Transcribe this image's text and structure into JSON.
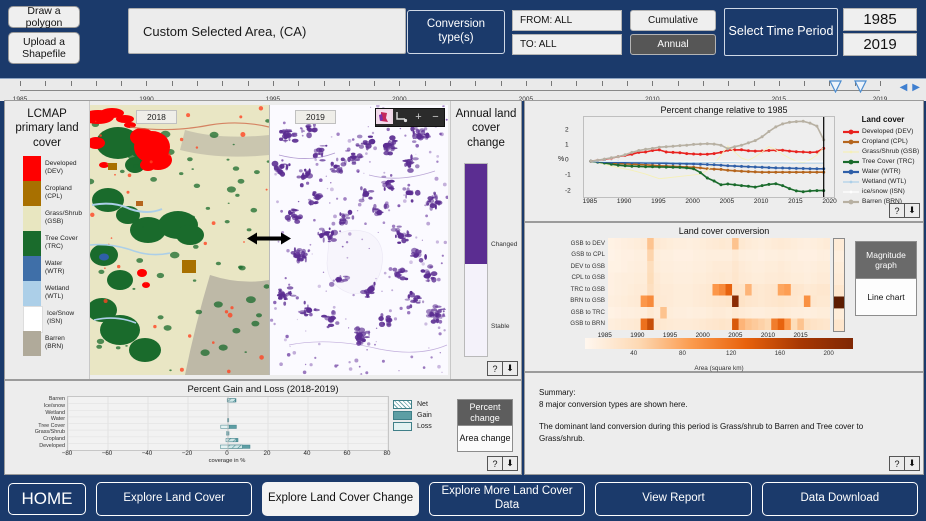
{
  "header": {
    "draw_polygon_label": "Draw a polygon",
    "upload_shapefile_label": "Upload a Shapefile",
    "area_label": "Custom Selected Area, (CA)",
    "conversion_types_label": "Conversion type(s)",
    "from_label": "FROM:  ALL",
    "to_label": "TO: ALL",
    "cumulative_label": "Cumulative",
    "annual_label": "Annual",
    "select_time_period_label": "Select Time Period",
    "year_start": "1985",
    "year_end": "2019"
  },
  "timeline": {
    "ticks": [
      1985,
      1986,
      1987,
      1988,
      1989,
      1990,
      1991,
      1992,
      1993,
      1994,
      1995,
      1996,
      1997,
      1998,
      1999,
      2000,
      2001,
      2002,
      2003,
      2004,
      2005,
      2006,
      2007,
      2008,
      2009,
      2010,
      2011,
      2012,
      2013,
      2014,
      2015,
      2016,
      2017,
      2018,
      2019
    ],
    "labels": [
      "1985",
      "1990",
      "1995",
      "2000",
      "2005",
      "2010",
      "2015",
      "2019"
    ],
    "label_years": [
      1985,
      1990,
      1995,
      2000,
      2005,
      2010,
      2015,
      2019
    ],
    "handle_start": 2018,
    "handle_end": 2019,
    "prev_icon": "prev-arrow-icon",
    "next_icon": "next-arrow-icon"
  },
  "legend": {
    "title": "LCMAP primary land cover",
    "items": [
      {
        "label": "Developed (DEV)",
        "color": "#ff0000"
      },
      {
        "label": "Cropland (CPL)",
        "color": "#a87000"
      },
      {
        "label": "Grass/Shrub (GSB)",
        "color": "#e8e6c0"
      },
      {
        "label": "Tree Cover (TRC)",
        "color": "#1a6b2c"
      },
      {
        "label": "Water (WTR)",
        "color": "#3f6fa8"
      },
      {
        "label": "Wetland (WTL)",
        "color": "#accfe8"
      },
      {
        "label": "Ice/Snow (ISN)",
        "color": "#ffffff"
      },
      {
        "label": "Barren (BRN)",
        "color": "#b0aa9a"
      }
    ]
  },
  "map": {
    "left_year": "2018",
    "right_year": "2019",
    "tools": [
      "thumbnail-icon",
      "swipe-icon",
      "zoom-in-icon",
      "zoom-out-icon"
    ],
    "zoom_in_glyph": "+",
    "zoom_out_glyph": "−"
  },
  "change_legend": {
    "title": "Annual land cover change",
    "changed_label": "Changed",
    "stable_label": "Stable",
    "changed_color": "#5b2d91",
    "stable_color": "#f4f2fa"
  },
  "help_buttons": {
    "help_glyph": "?",
    "download_glyph": "⬇"
  },
  "gain_loss": {
    "title": "Percent Gain and Loss (2018-2019)",
    "xlabel": "coverage in %",
    "legend": [
      {
        "label": "Net",
        "style": "hatched"
      },
      {
        "label": "Gain",
        "style": "solid"
      },
      {
        "label": "Loss",
        "style": "light"
      }
    ],
    "toggle": {
      "percent_change": "Percent change",
      "area_change": "Area change",
      "selected": "Percent change"
    }
  },
  "line_panel": {
    "magnitude_label": "Magnitude graph",
    "line_chart_label": "Line chart",
    "selected": "Magnitude graph"
  },
  "summary": {
    "heading": "Summary:",
    "line1": "8 major conversion types are shown here.",
    "line2": "The dominant land conversion during this period is Grass/shrub to Barren and Tree cover to Grass/shrub."
  },
  "nav": {
    "home_label": "HOME",
    "items": [
      {
        "label": "Explore Land Cover",
        "active": false
      },
      {
        "label": "Explore Land Cover Change",
        "active": true
      },
      {
        "label": "Explore More Land Cover Data",
        "active": false
      },
      {
        "label": "View Report",
        "active": false
      },
      {
        "label": "Data Download",
        "active": false
      }
    ]
  },
  "chart_data": [
    {
      "type": "line",
      "title": "Percent change relative to 1985",
      "xlabel": "",
      "ylabel": "%",
      "legend_title": "Land cover",
      "legend_position": "right",
      "grid": false,
      "xlim": [
        1984,
        2020.5
      ],
      "ylim": [
        -2.35,
        2.9
      ],
      "xticks": [
        1985,
        1990,
        1995,
        2000,
        2005,
        2010,
        2015,
        2020
      ],
      "yticks": [
        -2,
        -1,
        0,
        1,
        2
      ],
      "marker_year": 2019,
      "x": [
        1985,
        1986,
        1987,
        1988,
        1989,
        1990,
        1991,
        1992,
        1993,
        1994,
        1995,
        1996,
        1997,
        1998,
        1999,
        2000,
        2001,
        2002,
        2003,
        2004,
        2005,
        2006,
        2007,
        2008,
        2009,
        2010,
        2011,
        2012,
        2013,
        2014,
        2015,
        2016,
        2017,
        2018,
        2019
      ],
      "series": [
        {
          "name": "Developed (DEV)",
          "color": "#e8221f",
          "values": [
            0,
            0.05,
            0.12,
            0.2,
            0.3,
            0.38,
            0.46,
            0.58,
            0.6,
            0.7,
            0.74,
            0.6,
            0.58,
            0.56,
            0.5,
            0.47,
            0.45,
            0.46,
            0.5,
            0.58,
            0.72,
            0.74,
            0.75,
            0.68,
            0.66,
            0.67,
            0.7,
            0.72,
            0.72,
            0.66,
            0.62,
            0.6,
            0.58,
            0.6,
            0.84
          ]
        },
        {
          "name": "Cropland (CPL)",
          "color": "#b5651d",
          "values": [
            0,
            -0.05,
            -0.1,
            -0.13,
            -0.15,
            -0.17,
            -0.2,
            -0.22,
            -0.24,
            -0.27,
            -0.3,
            -0.32,
            -0.34,
            -0.36,
            -0.38,
            -0.4,
            -0.44,
            -0.5,
            -0.52,
            -0.54,
            -0.6,
            -0.63,
            -0.66,
            -0.68,
            -0.7,
            -0.72,
            -0.72,
            -0.72,
            -0.72,
            -0.72,
            -0.72,
            -0.72,
            -0.72,
            -0.72,
            -0.72
          ]
        },
        {
          "name": "Grass/Shrub (GSB)",
          "color": "#f5f0b8",
          "values": [
            0,
            -0.1,
            -0.2,
            -0.32,
            -0.42,
            -0.5,
            -0.6,
            -0.72,
            -0.85,
            -1.0,
            -1.15,
            -1.1,
            -1.05,
            -1.0,
            -0.95,
            -0.9,
            -0.85,
            -0.6,
            -0.2,
            0.4,
            1.0,
            0.6,
            0.2,
            0.05,
            0.3,
            0.6,
            0.95,
            0.75,
            0.45,
            0.2,
            0.0,
            -0.1,
            0.1,
            0.4,
            0.9
          ]
        },
        {
          "name": "Tree Cover (TRC)",
          "color": "#1a6b2c",
          "values": [
            0,
            -0.06,
            -0.12,
            -0.2,
            -0.26,
            -0.3,
            -0.33,
            -0.34,
            -0.36,
            -0.37,
            -0.38,
            -0.39,
            -0.4,
            -0.41,
            -0.44,
            -0.5,
            -0.75,
            -1.1,
            -1.3,
            -1.55,
            -1.5,
            -1.55,
            -1.6,
            -1.65,
            -1.7,
            -1.6,
            -1.52,
            -1.48,
            -1.6,
            -1.8,
            -1.95,
            -2.0,
            -1.95,
            -1.93,
            -1.93
          ]
        },
        {
          "name": "Water (WTR)",
          "color": "#2f5fa8",
          "values": [
            0,
            -0.02,
            -0.04,
            -0.06,
            -0.07,
            -0.08,
            -0.09,
            -0.1,
            -0.11,
            -0.12,
            -0.13,
            -0.14,
            -0.15,
            -0.16,
            -0.17,
            -0.18,
            -0.2,
            -0.22,
            -0.24,
            -0.26,
            -0.3,
            -0.32,
            -0.34,
            -0.36,
            -0.38,
            -0.4,
            -0.42,
            -0.44,
            -0.45,
            -0.46,
            -0.47,
            -0.48,
            -0.49,
            -0.5,
            -0.5
          ]
        },
        {
          "name": "Wetland (WTL)",
          "color": "#accfe8",
          "values": [
            0,
            -0.01,
            -0.02,
            -0.02,
            -0.03,
            -0.03,
            -0.04,
            -0.04,
            -0.05,
            -0.05,
            -0.06,
            -0.06,
            -0.07,
            -0.07,
            -0.08,
            -0.08,
            -0.08,
            -0.09,
            -0.09,
            -0.1,
            -0.1,
            -0.1,
            -0.11,
            -0.11,
            -0.11,
            -0.12,
            -0.12,
            -0.12,
            -0.12,
            -0.13,
            -0.13,
            -0.13,
            -0.13,
            -0.13,
            -0.13
          ]
        },
        {
          "name": "ice/snow (ISN)",
          "color": "#ffffff",
          "values": [
            0,
            0,
            0,
            0,
            0,
            0,
            0,
            0,
            0,
            0,
            0,
            0,
            0,
            0,
            0,
            0,
            0,
            0,
            0,
            0,
            0,
            0,
            0,
            0,
            0,
            0,
            0,
            0,
            0,
            0,
            0,
            0,
            0,
            0,
            0
          ]
        },
        {
          "name": "Barren (BRN)",
          "color": "#b7b0a2",
          "values": [
            0,
            0.06,
            0.14,
            0.22,
            0.3,
            0.42,
            0.58,
            0.7,
            0.78,
            0.84,
            0.92,
            0.95,
            0.98,
            1.02,
            1.05,
            1.1,
            1.12,
            1.15,
            1.12,
            1.05,
            0.82,
            0.95,
            1.05,
            1.2,
            1.35,
            1.6,
            1.95,
            2.25,
            2.45,
            2.55,
            2.6,
            2.62,
            2.5,
            2.3,
            1.4
          ]
        }
      ]
    },
    {
      "type": "heatmap",
      "title": "Land cover conversion",
      "xlabel": "",
      "ylabel": "",
      "colorbar_label": "Area (square km)",
      "colorbar_ticks": [
        40,
        80,
        120,
        160,
        200
      ],
      "colorbar_range": [
        0,
        220
      ],
      "xticks": [
        1985,
        1990,
        1995,
        2000,
        2005,
        2010,
        2015
      ],
      "x": [
        1986,
        1987,
        1988,
        1989,
        1990,
        1991,
        1992,
        1993,
        1994,
        1995,
        1996,
        1997,
        1998,
        1999,
        2000,
        2001,
        2002,
        2003,
        2004,
        2005,
        2006,
        2007,
        2008,
        2009,
        2010,
        2011,
        2012,
        2013,
        2014,
        2015,
        2016,
        2017,
        2018,
        2019
      ],
      "rows": [
        "GSB to DEV",
        "GSB to CPL",
        "DEV to GSB",
        "CPL to GSB",
        "TRC to GSB",
        "BRN to GSB",
        "GSB to TRC",
        "GSB to BRN"
      ],
      "values": [
        [
          8,
          10,
          12,
          14,
          16,
          18,
          60,
          22,
          18,
          16,
          14,
          14,
          12,
          14,
          16,
          18,
          20,
          22,
          20,
          60,
          22,
          18,
          16,
          14,
          16,
          18,
          20,
          18,
          16,
          14,
          12,
          14,
          16,
          18
        ],
        [
          6,
          8,
          10,
          10,
          12,
          12,
          48,
          14,
          12,
          12,
          10,
          10,
          10,
          12,
          12,
          14,
          14,
          14,
          14,
          20,
          14,
          12,
          12,
          10,
          12,
          12,
          14,
          12,
          12,
          10,
          10,
          10,
          12,
          12
        ],
        [
          8,
          8,
          10,
          12,
          14,
          14,
          38,
          16,
          14,
          14,
          12,
          12,
          12,
          14,
          14,
          16,
          18,
          18,
          18,
          24,
          18,
          16,
          14,
          14,
          16,
          16,
          18,
          16,
          14,
          14,
          12,
          14,
          16,
          16
        ],
        [
          10,
          12,
          14,
          14,
          16,
          16,
          40,
          20,
          16,
          16,
          14,
          14,
          14,
          16,
          16,
          18,
          20,
          22,
          20,
          26,
          20,
          18,
          16,
          16,
          18,
          18,
          20,
          18,
          16,
          16,
          14,
          16,
          18,
          18
        ],
        [
          10,
          12,
          14,
          16,
          18,
          18,
          36,
          22,
          18,
          18,
          16,
          16,
          16,
          18,
          20,
          22,
          90,
          100,
          130,
          30,
          28,
          70,
          24,
          22,
          24,
          26,
          80,
          85,
          26,
          24,
          20,
          22,
          24,
          24
        ],
        [
          12,
          14,
          16,
          18,
          20,
          90,
          100,
          22,
          20,
          18,
          16,
          16,
          16,
          18,
          20,
          22,
          24,
          26,
          28,
          200,
          30,
          26,
          24,
          22,
          24,
          26,
          28,
          26,
          24,
          22,
          95,
          24,
          22,
          22
        ],
        [
          8,
          10,
          12,
          12,
          14,
          14,
          22,
          16,
          60,
          16,
          14,
          14,
          12,
          14,
          14,
          16,
          18,
          18,
          16,
          22,
          18,
          16,
          14,
          14,
          16,
          16,
          18,
          16,
          14,
          14,
          12,
          14,
          16,
          16
        ],
        [
          14,
          16,
          18,
          20,
          22,
          120,
          150,
          24,
          22,
          20,
          18,
          18,
          18,
          20,
          22,
          24,
          26,
          28,
          26,
          140,
          70,
          60,
          55,
          50,
          45,
          110,
          130,
          90,
          40,
          60,
          35,
          30,
          28,
          26
        ]
      ]
    },
    {
      "type": "bar",
      "orientation": "horizontal",
      "title": "Percent Gain and Loss (2018-2019)",
      "xlabel": "coverage in %",
      "ylabel": "",
      "xlim": [
        -80,
        80
      ],
      "xticks": [
        -80,
        -60,
        -40,
        -20,
        0,
        20,
        40,
        60,
        80
      ],
      "categories": [
        "Developed",
        "Cropland",
        "Grass/Shrub",
        "Tree Cover",
        "Water",
        "Wetland",
        "Ice/snow",
        "Barren"
      ],
      "series": [
        {
          "name": "Net",
          "values": [
            7.2,
            4.0,
            -0.3,
            0.6,
            0.1,
            0.0,
            0.0,
            3.6
          ]
        },
        {
          "name": "Gain",
          "values": [
            11.0,
            5.0,
            0.5,
            4.2,
            0.4,
            0.0,
            0.0,
            4.0
          ]
        },
        {
          "name": "Loss",
          "values": [
            -3.8,
            -1.0,
            -0.8,
            -3.6,
            -0.3,
            0.0,
            0.0,
            -0.4
          ]
        }
      ]
    }
  ]
}
